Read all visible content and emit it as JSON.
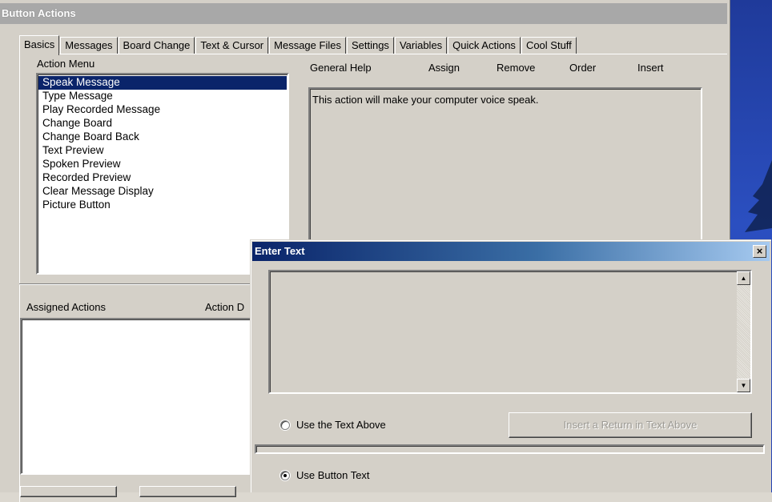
{
  "window": {
    "title": "Button Actions"
  },
  "tabs": [
    {
      "label": "Basics",
      "active": true
    },
    {
      "label": "Messages"
    },
    {
      "label": "Board Change"
    },
    {
      "label": "Text & Cursor"
    },
    {
      "label": "Message Files"
    },
    {
      "label": "Settings"
    },
    {
      "label": "Variables"
    },
    {
      "label": "Quick Actions"
    },
    {
      "label": "Cool Stuff"
    }
  ],
  "action_menu": {
    "label": "Action Menu",
    "items": [
      "Speak Message",
      "Type Message",
      "Play Recorded Message",
      "Change Board",
      "Change Board Back",
      "Text Preview",
      "Spoken Preview",
      "Recorded Preview",
      "Clear Message Display",
      "Picture Button"
    ],
    "selected": "Speak Message"
  },
  "help_bar": {
    "general_help": "General Help",
    "assign": "Assign",
    "remove": "Remove",
    "order": "Order",
    "insert": "Insert"
  },
  "help_text": "This action will make your computer voice speak.",
  "assigned": {
    "label": "Assigned Actions",
    "action_d_label": "Action D"
  },
  "dialog": {
    "title": "Enter Text",
    "close_glyph": "×",
    "text_value": "",
    "use_text_above": "Use the Text Above",
    "insert_return": "Insert a Return in Text Above",
    "use_button_text": "Use Button Text",
    "selected_option": "Use Button Text"
  },
  "colors": {
    "selection": "#0a246a",
    "title_active_start": "#0a246a",
    "title_inactive": "#a8a8a8",
    "face": "#d4d0c8"
  }
}
